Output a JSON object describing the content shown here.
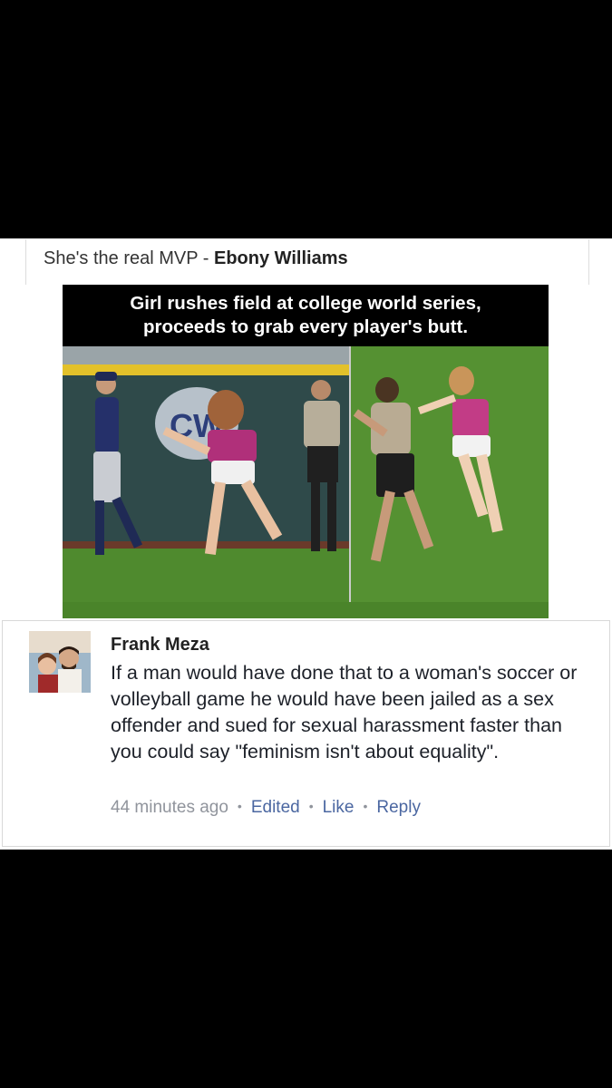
{
  "post": {
    "prefix": "She's the real MVP - ",
    "author": "Ebony Williams"
  },
  "meme": {
    "title_line1": "Girl rushes field at college world series,",
    "title_line2": "proceeds to grab every player's butt.",
    "left_photo": "player-and-woman-on-field",
    "right_photo": "guard-chasing-woman"
  },
  "comment": {
    "author": "Frank Meza",
    "text": "If a man would have done that to a woman's soccer or volleyball game he would have been jailed as a sex offender and sued for sexual harassment faster than you could say \"feminism isn't about equality\".",
    "time": "44 minutes ago",
    "edited": "Edited",
    "like": "Like",
    "reply": "Reply"
  },
  "colors": {
    "link": "#4b67a1",
    "meta": "#90949c",
    "grass": "#4f8a2e"
  }
}
